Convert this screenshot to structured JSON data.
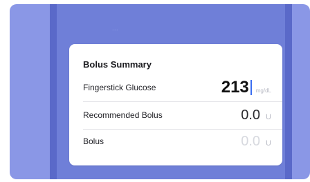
{
  "header": {
    "faded_text": "..."
  },
  "card": {
    "title": "Bolus Summary",
    "rows": [
      {
        "label": "Fingerstick Glucose",
        "value": "213",
        "unit": "mg/dL"
      },
      {
        "label": "Recommended Bolus",
        "value": "0.0",
        "unit": "U"
      },
      {
        "label": "Bolus",
        "value": "0.0",
        "unit": "U"
      }
    ]
  },
  "colors": {
    "backdrop": "#8a97e6",
    "band": "#5a69c9",
    "cursor": "#3a6df0"
  }
}
